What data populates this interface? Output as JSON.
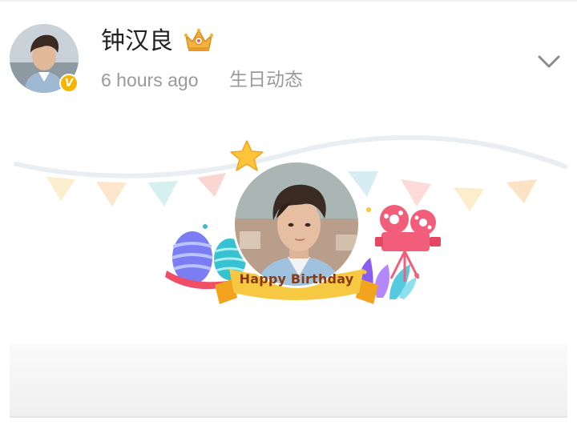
{
  "post": {
    "author": "钟汉良",
    "time": "6 hours ago",
    "source": "生日动态"
  },
  "card": {
    "banner": "Happy Birthday"
  },
  "icons": {
    "verified": "verified-v-badge",
    "crown": "crown-icon",
    "menu": "chevron-down-icon",
    "star": "star-icon",
    "camera": "film-camera-icon",
    "eggs": "easter-eggs-icon",
    "leaves": "leaves-icon",
    "ribbon": "ribbon-banner"
  },
  "colors": {
    "verified_badge": "#f7b500",
    "meta_text": "#9a9a9a",
    "name_text": "#222222",
    "banner_yellow": "#f7c943",
    "banner_text": "#8a3a12"
  },
  "badge_text": "V"
}
